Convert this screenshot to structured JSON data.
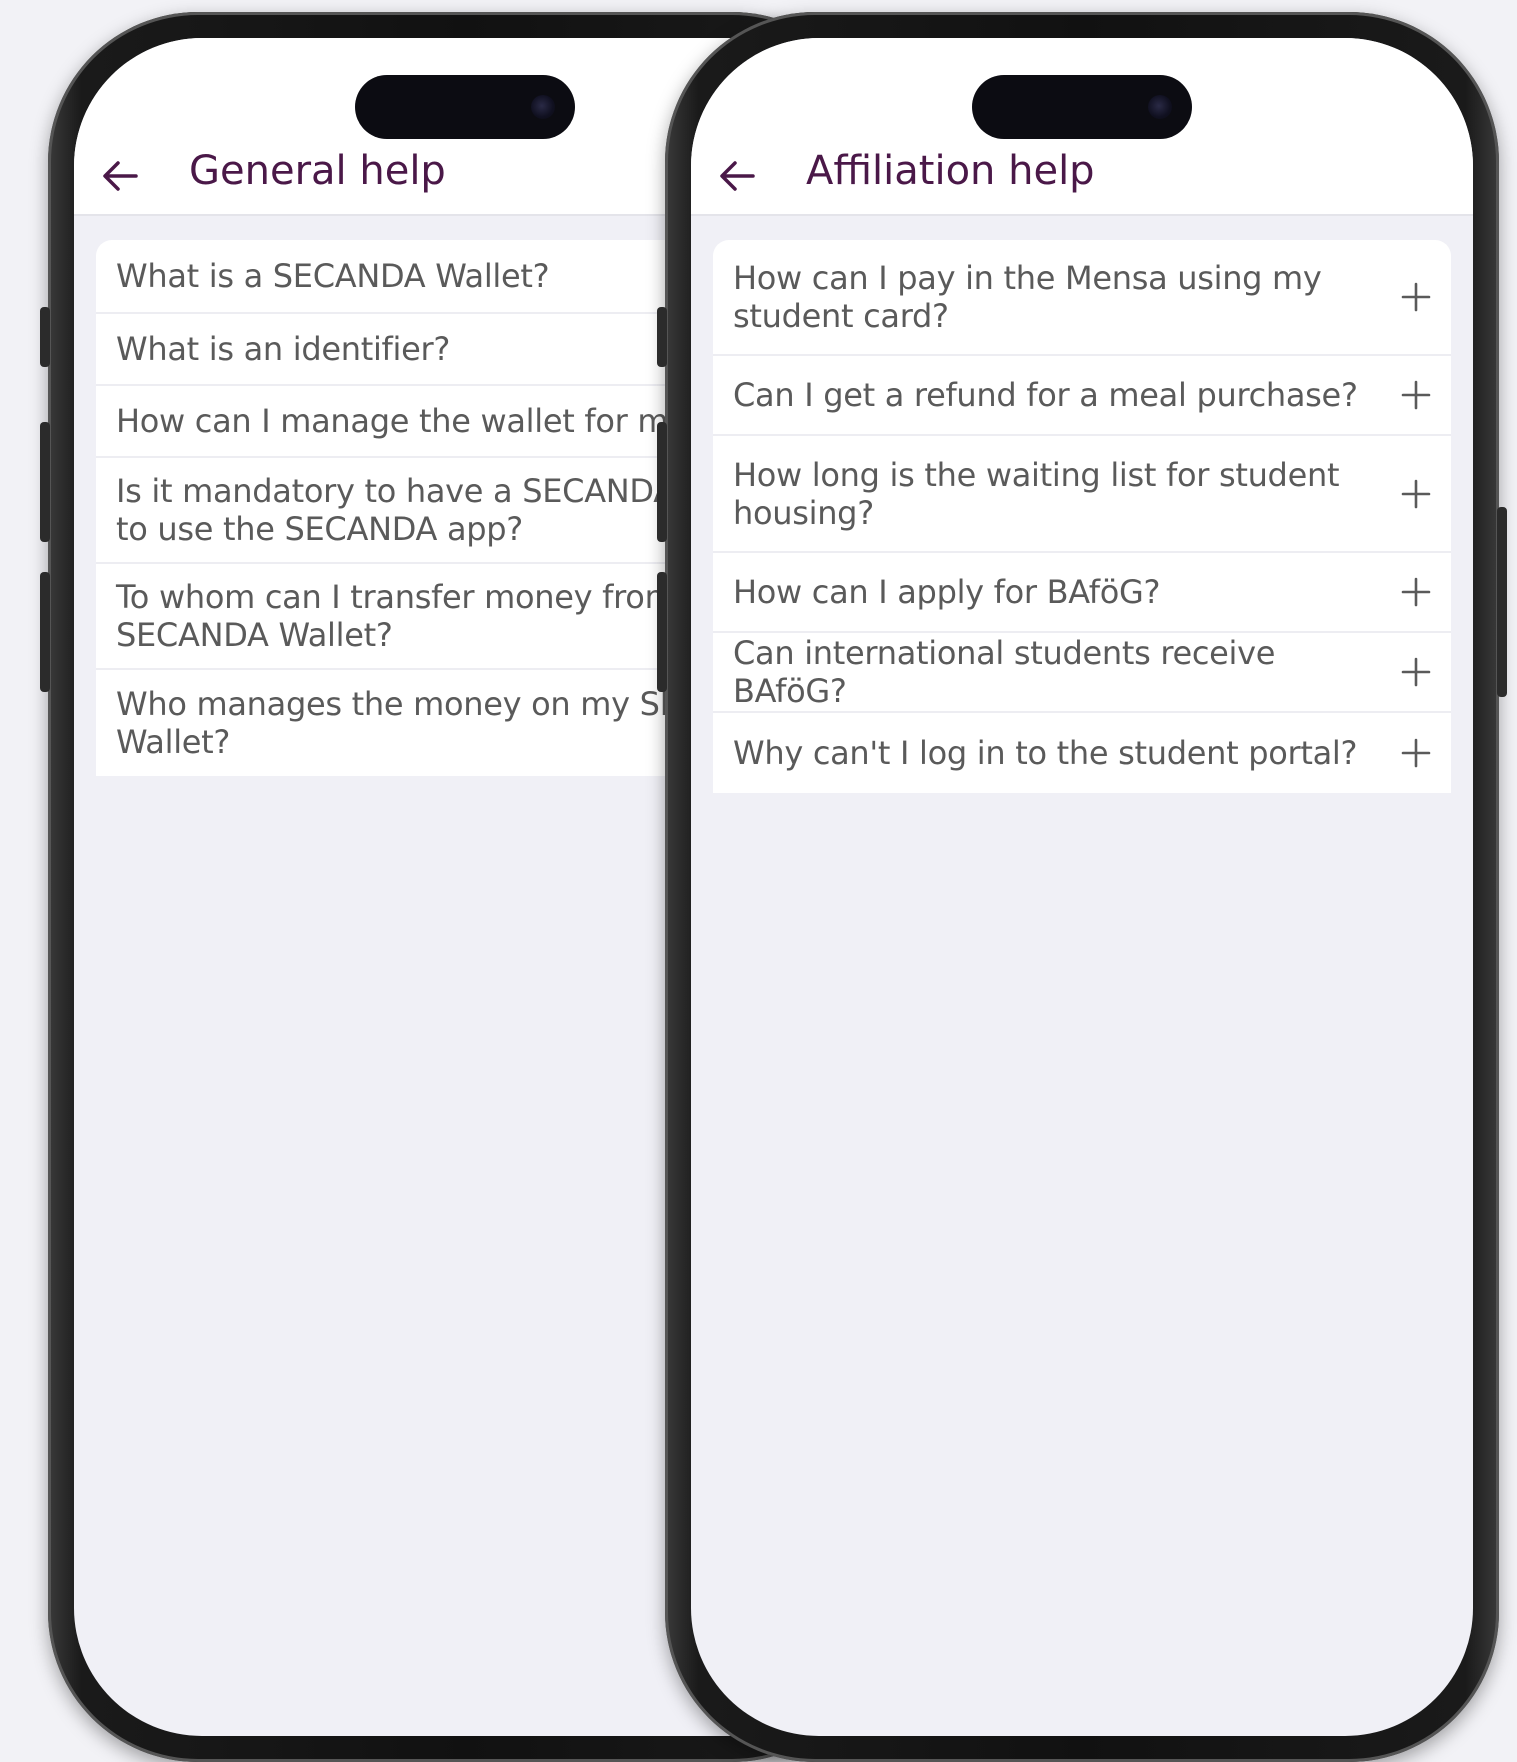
{
  "colors": {
    "background": "#f2f2f6",
    "appbar": "#ffffff",
    "title": "#4a1848",
    "question_text": "#5a5a5a"
  },
  "left_screen": {
    "title": "General help",
    "back_icon": "arrow-left-icon",
    "items": [
      {
        "line1": "What is a SECANDA Wallet?",
        "line2": ""
      },
      {
        "line1": "What is an identifier?",
        "line2": ""
      },
      {
        "line1": "How can I manage the wallet for my ch",
        "line2": ""
      },
      {
        "line1": "Is it mandatory to have a SECANDA W",
        "line2": "to use the SECANDA app?"
      },
      {
        "line1": "To whom can I transfer money from m",
        "line2": "SECANDA Wallet?"
      },
      {
        "line1": "Who manages the money on my SECA",
        "line2": "Wallet?"
      }
    ]
  },
  "right_screen": {
    "title": "Affiliation help",
    "back_icon": "arrow-left-icon",
    "expand_icon": "plus-icon",
    "items": [
      {
        "line1": "How can I pay in the Mensa using my",
        "line2": "student card?"
      },
      {
        "line1": "Can I get a refund for a meal purchase?",
        "line2": ""
      },
      {
        "line1": "How long is the waiting list for student",
        "line2": "housing?"
      },
      {
        "line1": "How can I apply for BAföG?",
        "line2": ""
      },
      {
        "line1": "Can international students receive BAföG?",
        "line2": ""
      },
      {
        "line1": "Why can't I log in to the student portal?",
        "line2": ""
      }
    ]
  }
}
